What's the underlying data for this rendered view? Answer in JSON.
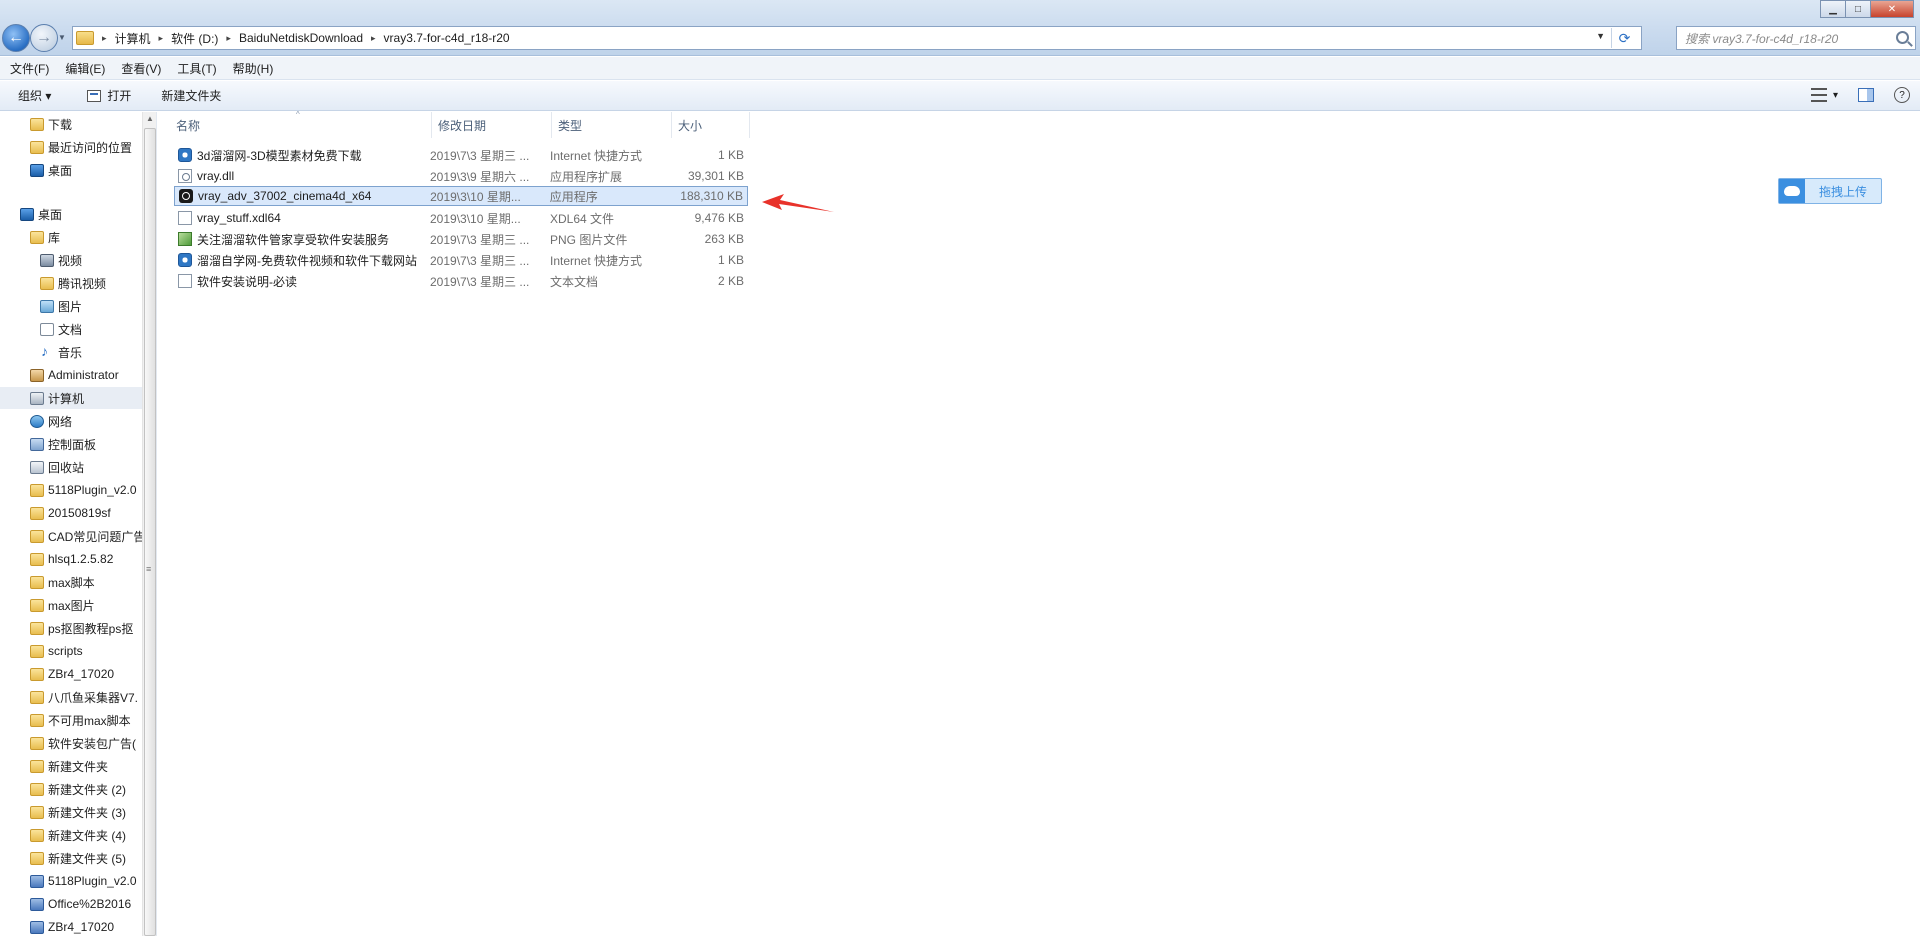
{
  "window": {
    "min_label": "▁",
    "max_label": "□",
    "close_label": "✕"
  },
  "address": {
    "crumbs": [
      "计算机",
      "软件 (D:)",
      "BaiduNetdiskDownload",
      "vray3.7-for-c4d_r18-r20"
    ],
    "separator": "▸",
    "search_placeholder": "搜索 vray3.7-for-c4d_r18-r20"
  },
  "menubar": {
    "items": [
      "文件(F)",
      "编辑(E)",
      "查看(V)",
      "工具(T)",
      "帮助(H)"
    ]
  },
  "commandbar": {
    "organize": "组织 ▾",
    "open": "打开",
    "new_folder": "新建文件夹",
    "view_dropdown": "▾",
    "help": "?"
  },
  "navpane": {
    "items": [
      {
        "label": "下载",
        "icon": "download-folder-icon"
      },
      {
        "label": "最近访问的位置",
        "icon": "recent-places-icon"
      },
      {
        "label": "桌面",
        "icon": "desktop-icon"
      },
      {
        "label": "桌面",
        "icon": "desktop-icon"
      },
      {
        "label": "库",
        "icon": "library-icon"
      },
      {
        "label": "视频",
        "icon": "video-icon"
      },
      {
        "label": "腾讯视频",
        "icon": "folder-icon"
      },
      {
        "label": "图片",
        "icon": "pictures-icon"
      },
      {
        "label": "文档",
        "icon": "documents-icon"
      },
      {
        "label": "音乐",
        "icon": "music-icon"
      },
      {
        "label": "Administrator",
        "icon": "user-folder-icon"
      },
      {
        "label": "计算机",
        "icon": "computer-icon"
      },
      {
        "label": "网络",
        "icon": "network-icon"
      },
      {
        "label": "控制面板",
        "icon": "control-panel-icon"
      },
      {
        "label": "回收站",
        "icon": "recycle-bin-icon"
      },
      {
        "label": "5118Plugin_v2.0",
        "icon": "folder-icon"
      },
      {
        "label": "20150819sf",
        "icon": "folder-icon"
      },
      {
        "label": "CAD常见问题广告",
        "icon": "folder-icon"
      },
      {
        "label": "hlsq1.2.5.82",
        "icon": "folder-icon"
      },
      {
        "label": "max脚本",
        "icon": "folder-icon"
      },
      {
        "label": "max图片",
        "icon": "folder-icon"
      },
      {
        "label": "ps抠图教程ps抠",
        "icon": "folder-icon"
      },
      {
        "label": "scripts",
        "icon": "folder-icon"
      },
      {
        "label": "ZBr4_17020",
        "icon": "folder-icon"
      },
      {
        "label": "八爪鱼采集器V7.",
        "icon": "folder-icon"
      },
      {
        "label": "不可用max脚本",
        "icon": "folder-icon"
      },
      {
        "label": "软件安装包广告(",
        "icon": "folder-icon"
      },
      {
        "label": "新建文件夹",
        "icon": "folder-icon"
      },
      {
        "label": "新建文件夹 (2)",
        "icon": "folder-icon"
      },
      {
        "label": "新建文件夹 (3)",
        "icon": "folder-icon"
      },
      {
        "label": "新建文件夹 (4)",
        "icon": "folder-icon"
      },
      {
        "label": "新建文件夹 (5)",
        "icon": "folder-icon"
      },
      {
        "label": "5118Plugin_v2.0",
        "icon": "zip-icon"
      },
      {
        "label": "Office%2B2016",
        "icon": "zip-icon"
      },
      {
        "label": "ZBr4_17020",
        "icon": "zip-icon"
      }
    ]
  },
  "filelist": {
    "columns": [
      "名称",
      "修改日期",
      "类型",
      "大小"
    ],
    "files": [
      {
        "name": "3d溜溜网-3D模型素材免费下载",
        "date": "2019\\7\\3 星期三 ...",
        "type": "Internet 快捷方式",
        "size": "1 KB",
        "icon": "internet-shortcut-icon"
      },
      {
        "name": "vray.dll",
        "date": "2019\\3\\9 星期六 ...",
        "type": "应用程序扩展",
        "size": "39,301 KB",
        "icon": "dll-file-icon"
      },
      {
        "name": "vray_adv_37002_cinema4d_x64",
        "date": "2019\\3\\10 星期...",
        "type": "应用程序",
        "size": "188,310 KB",
        "icon": "vray-exe-icon"
      },
      {
        "name": "vray_stuff.xdl64",
        "date": "2019\\3\\10 星期...",
        "type": "XDL64 文件",
        "size": "9,476 KB",
        "icon": "generic-file-icon"
      },
      {
        "name": "关注溜溜软件管家享受软件安装服务",
        "date": "2019\\7\\3 星期三 ...",
        "type": "PNG 图片文件",
        "size": "263 KB",
        "icon": "png-file-icon"
      },
      {
        "name": "溜溜自学网-免费软件视频和软件下载网站",
        "date": "2019\\7\\3 星期三 ...",
        "type": "Internet 快捷方式",
        "size": "1 KB",
        "icon": "internet-shortcut-icon"
      },
      {
        "name": "软件安装说明-必读",
        "date": "2019\\7\\3 星期三 ...",
        "type": "文本文档",
        "size": "2 KB",
        "icon": "text-file-icon"
      }
    ]
  },
  "cloud_upload": {
    "label": "拖拽上传"
  },
  "colors": {
    "selection": "#d9e8fb",
    "arrow": "#e8322a",
    "cloud_accent": "#3b8fe0"
  }
}
